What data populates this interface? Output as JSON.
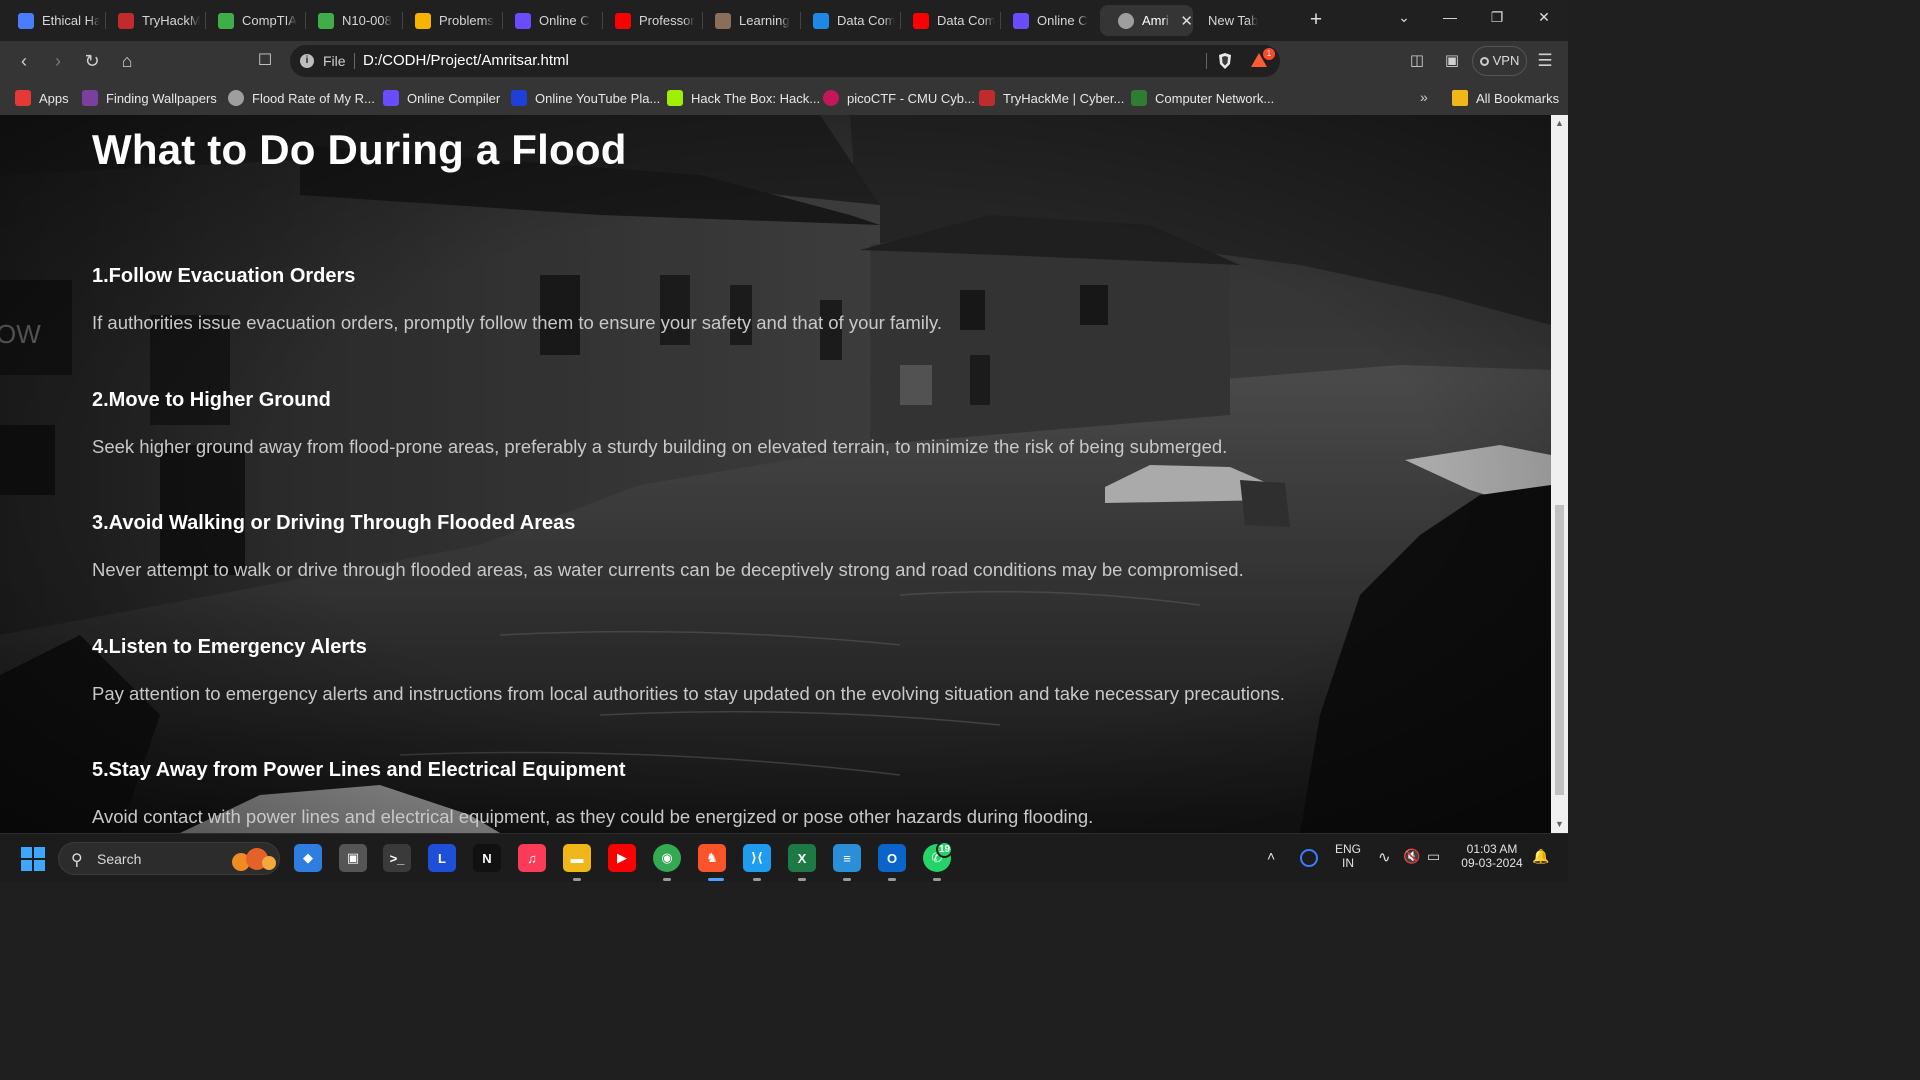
{
  "tabs": [
    {
      "label": "Ethical Ha",
      "icon": "docs-icon",
      "color": "#4a7cff"
    },
    {
      "label": "TryHackM",
      "icon": "tryhackme-icon",
      "color": "#c12b2b"
    },
    {
      "label": "CompTIA",
      "icon": "comptia-icon",
      "color": "#3fae49"
    },
    {
      "label": "N10-008",
      "icon": "comptia-icon",
      "color": "#3fae49"
    },
    {
      "label": "Problems",
      "icon": "problems-icon",
      "color": "#f4b400"
    },
    {
      "label": "Online C",
      "icon": "programiz-icon",
      "color": "#6b4bff"
    },
    {
      "label": "Professor",
      "icon": "youtube-icon",
      "color": "#ff0000"
    },
    {
      "label": "Learning",
      "icon": "learning-icon",
      "color": "#8a6d5a"
    },
    {
      "label": "Data Com",
      "icon": "pdf-icon",
      "color": "#1e88e5"
    },
    {
      "label": "Data Com",
      "icon": "youtube-icon",
      "color": "#ff0000"
    },
    {
      "label": "Online C",
      "icon": "programiz-icon",
      "color": "#6b4bff"
    },
    {
      "label": "Amrit",
      "icon": "globe-icon",
      "color": "#9e9e9e",
      "active": true
    },
    {
      "label": "New Tab",
      "icon": "",
      "color": ""
    }
  ],
  "window": {
    "minimize": "—",
    "maximize": "❐",
    "close": "✕",
    "tab_search": "⌄",
    "new_tab": "+"
  },
  "address": {
    "scheme": "File",
    "url": "D:/CODH/Project/Amritsar.html",
    "rewards_count": "1"
  },
  "toolbar": {
    "vpn_label": "VPN"
  },
  "bookmarks": [
    {
      "label": "Apps",
      "icon": "apps-grid-icon",
      "color": "#e53935"
    },
    {
      "label": "Finding Wallpapers",
      "icon": "wallpaper-icon",
      "color": "#7b3fa0"
    },
    {
      "label": "Flood Rate of My R...",
      "icon": "globe-icon",
      "color": "#9e9e9e"
    },
    {
      "label": "Online Compiler",
      "icon": "programiz-icon",
      "color": "#6b4bff"
    },
    {
      "label": "Online YouTube Pla...",
      "icon": "ten-icon",
      "color": "#1e40d8"
    },
    {
      "label": "Hack The Box: Hack...",
      "icon": "htb-icon",
      "color": "#9fef00"
    },
    {
      "label": "picoCTF - CMU Cyb...",
      "icon": "picoctf-icon",
      "color": "#c2185b"
    },
    {
      "label": "TryHackMe | Cyber...",
      "icon": "tryhackme-icon",
      "color": "#c12b2b"
    },
    {
      "label": "Computer Network...",
      "icon": "network-icon",
      "color": "#2e7d32"
    }
  ],
  "bookmarks_overflow": "»",
  "all_bookmarks": "All Bookmarks",
  "page": {
    "heading": "What to Do During a Flood",
    "partial_sign_text": "OW",
    "steps": [
      {
        "title": "1.Follow Evacuation Orders",
        "desc": "If authorities issue evacuation orders, promptly follow them to ensure your safety and that of your family."
      },
      {
        "title": "2.Move to Higher Ground",
        "desc": "Seek higher ground away from flood-prone areas, preferably a sturdy building on elevated terrain, to minimize the risk of being submerged."
      },
      {
        "title": "3.Avoid Walking or Driving Through Flooded Areas",
        "desc": "Never attempt to walk or drive through flooded areas, as water currents can be deceptively strong and road conditions may be compromised."
      },
      {
        "title": "4.Listen to Emergency Alerts",
        "desc": "Pay attention to emergency alerts and instructions from local authorities to stay updated on the evolving situation and take necessary precautions."
      },
      {
        "title": "5.Stay Away from Power Lines and Electrical Equipment",
        "desc": "Avoid contact with power lines and electrical equipment, as they could be energized or pose other hazards during flooding."
      }
    ]
  },
  "taskbar": {
    "search_label": "Search",
    "apps": [
      {
        "name": "copilot-icon",
        "glyph": "◆",
        "color": "#2f7de1"
      },
      {
        "name": "task-view-icon",
        "glyph": "▣",
        "color": "#555555"
      },
      {
        "name": "terminal-icon",
        "glyph": ">_",
        "color": "#3a3a3a"
      },
      {
        "name": "launcher-l-icon",
        "glyph": "L",
        "color": "#1e4fd6"
      },
      {
        "name": "notion-icon",
        "glyph": "N",
        "color": "#111111"
      },
      {
        "name": "music-icon",
        "glyph": "♫",
        "color": "#fa3c5a"
      },
      {
        "name": "file-explorer-icon",
        "glyph": "▬",
        "color": "#f1b719"
      },
      {
        "name": "youtube-app-icon",
        "glyph": "▶",
        "color": "#ff0000"
      },
      {
        "name": "chrome-icon",
        "glyph": "◉",
        "color": "#34a853"
      },
      {
        "name": "brave-icon",
        "glyph": "♞",
        "color": "#fb542b"
      },
      {
        "name": "vscode-icon",
        "glyph": "⟩⟨",
        "color": "#1f9cf0"
      },
      {
        "name": "excel-icon",
        "glyph": "X",
        "color": "#1d7a45"
      },
      {
        "name": "notepad-icon",
        "glyph": "≡",
        "color": "#2a8fd6"
      },
      {
        "name": "outlook-icon",
        "glyph": "O",
        "color": "#0a64c9"
      },
      {
        "name": "whatsapp-icon",
        "glyph": "✆",
        "color": "#25d366"
      }
    ],
    "whatsapp_badge": "19",
    "language": "ENG",
    "region": "IN",
    "time": "01:03 AM",
    "date": "09-03-2024"
  }
}
